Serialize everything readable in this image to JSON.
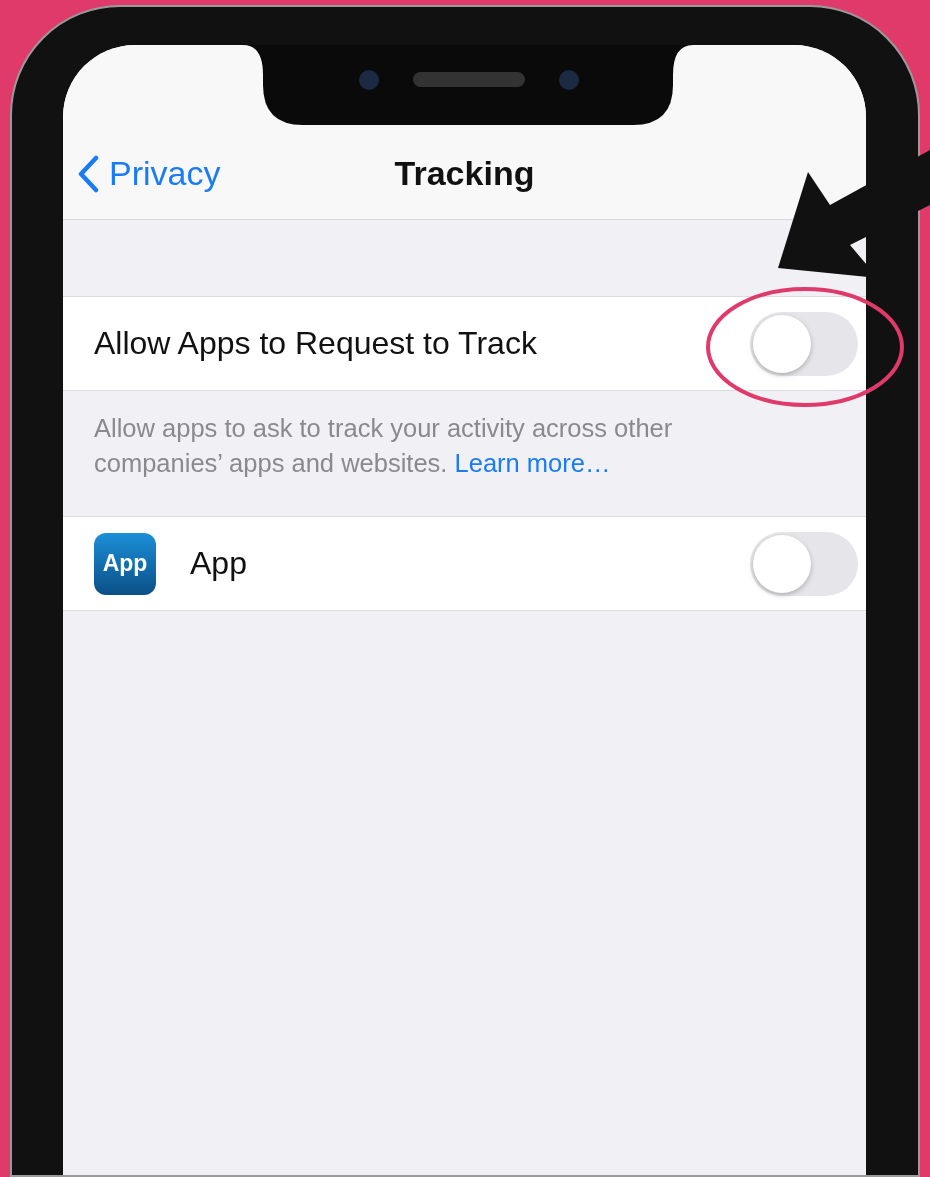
{
  "nav": {
    "back_label": "Privacy",
    "title": "Tracking"
  },
  "settings": [
    {
      "label": "Allow Apps to Request to Track",
      "on": false
    }
  ],
  "footer": {
    "text": "Allow apps to ask to track your activity across other companies’ apps and websites.",
    "link": "Learn more…"
  },
  "apps": [
    {
      "name": "App",
      "icon_text": "App",
      "on": false
    }
  ]
}
